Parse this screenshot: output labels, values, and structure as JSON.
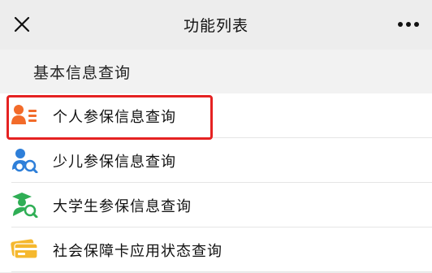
{
  "navbar": {
    "title": "功能列表",
    "close_icon": "close-icon",
    "more_icon": "more-icon"
  },
  "section": {
    "title": "基本信息查询"
  },
  "items": [
    {
      "label": "个人参保信息查询",
      "icon": "person-card-icon",
      "color": "#f26b2a",
      "highlighted": true
    },
    {
      "label": "少儿参保信息查询",
      "icon": "child-search-icon",
      "color": "#2e7fd9",
      "highlighted": false
    },
    {
      "label": "大学生参保信息查询",
      "icon": "graduate-search-icon",
      "color": "#2fae55",
      "highlighted": false
    },
    {
      "label": "社会保障卡应用状态查询",
      "icon": "card-icon",
      "color": "#f5b82e",
      "highlighted": false
    }
  ],
  "colors": {
    "highlight": "#e52222"
  }
}
